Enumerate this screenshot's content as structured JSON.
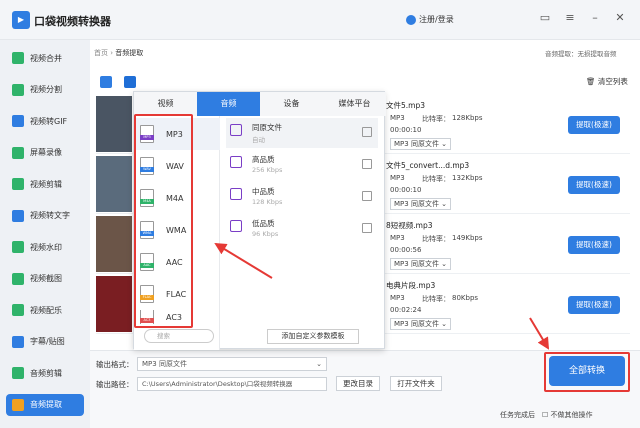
{
  "app": {
    "title": "口袋视频转换器",
    "login": "注册/登录"
  },
  "sidebar": {
    "items": [
      {
        "label": "视频合并",
        "color": "#2fb36a"
      },
      {
        "label": "视频分割",
        "color": "#2fb36a"
      },
      {
        "label": "视频转GIF",
        "color": "#2f7de1"
      },
      {
        "label": "屏幕录像",
        "color": "#2fb36a"
      },
      {
        "label": "视频剪辑",
        "color": "#2fb36a"
      },
      {
        "label": "视频转文字",
        "color": "#2f7de1"
      },
      {
        "label": "视频水印",
        "color": "#2fb36a"
      },
      {
        "label": "视频截图",
        "color": "#2fb36a"
      },
      {
        "label": "视频配乐",
        "color": "#2fb36a"
      },
      {
        "label": "字幕/贴图",
        "color": "#2f7de1"
      },
      {
        "label": "音频剪辑",
        "color": "#2fb36a"
      },
      {
        "label": "音频提取",
        "color": "#f0a020"
      }
    ]
  },
  "breadcrumb": {
    "home": "首页",
    "current": "音频提取"
  },
  "format_hint": "音频提取：无损提取音频",
  "clear_list": "清空列表",
  "files": [
    {
      "name": "文件5.mp3",
      "fmt": "MP3",
      "bitrate_label": "比特率：",
      "bitrate": "128Kbps",
      "duration": "00:00:10",
      "quality": "同原文件",
      "action": "提取(极速)",
      "thumb": "#4a5563"
    },
    {
      "name": "文件5_convert...d.mp3",
      "fmt": "MP3",
      "bitrate_label": "比特率：",
      "bitrate": "132Kbps",
      "duration": "00:00:10",
      "quality": "同原文件",
      "action": "提取(极速)",
      "thumb": "#5a6b7c"
    },
    {
      "name": "8短视频.mp3",
      "fmt": "MP3",
      "bitrate_label": "比特率：",
      "bitrate": "149Kbps",
      "duration": "00:00:56",
      "quality": "同原文件",
      "action": "提取(极速)",
      "thumb": "#6b5548"
    },
    {
      "name": "电典片段.mp3",
      "fmt": "MP3",
      "bitrate_label": "比特率：",
      "bitrate": "80Kbps",
      "duration": "00:02:24",
      "quality": "同原文件",
      "action": "提取(极速)",
      "thumb": "#7a1e22"
    }
  ],
  "popup": {
    "tabs": [
      "视频",
      "音频",
      "设备",
      "媒体平台"
    ],
    "active_tab": 1,
    "formats": [
      {
        "label": "MP3",
        "band": "MP3",
        "color": "#7a3ec6"
      },
      {
        "label": "WAV",
        "band": "WAV",
        "color": "#2f7de1"
      },
      {
        "label": "M4A",
        "band": "M4A",
        "color": "#2fb36a"
      },
      {
        "label": "WMA",
        "band": "WMA",
        "color": "#2f7de1"
      },
      {
        "label": "AAC",
        "band": "AAC",
        "color": "#2fb36a"
      },
      {
        "label": "FLAC",
        "band": "FLAC",
        "color": "#f0a020"
      },
      {
        "label": "AC3",
        "band": "AC3",
        "color": "#e05050"
      }
    ],
    "qualities": [
      {
        "name": "同原文件",
        "sub": "自动"
      },
      {
        "name": "高品质",
        "sub": "256 Kbps"
      },
      {
        "name": "中品质",
        "sub": "128 Kbps"
      },
      {
        "name": "低品质",
        "sub": "96 Kbps"
      }
    ],
    "search_placeholder": "搜索",
    "add_template": "添加自定义参数模板"
  },
  "output": {
    "format_label": "输出格式：",
    "format_value": "MP3  同原文件",
    "path_label": "输出路径：",
    "path_value": "C:\\Users\\Administrator\\Desktop\\口袋视频转换器",
    "change_dir": "更改目录",
    "open_folder": "打开文件夹",
    "convert_all": "全部转换",
    "after_done": "任务完成后",
    "checkbox_label": "不做其他操作"
  },
  "accent": "#2f7de1"
}
